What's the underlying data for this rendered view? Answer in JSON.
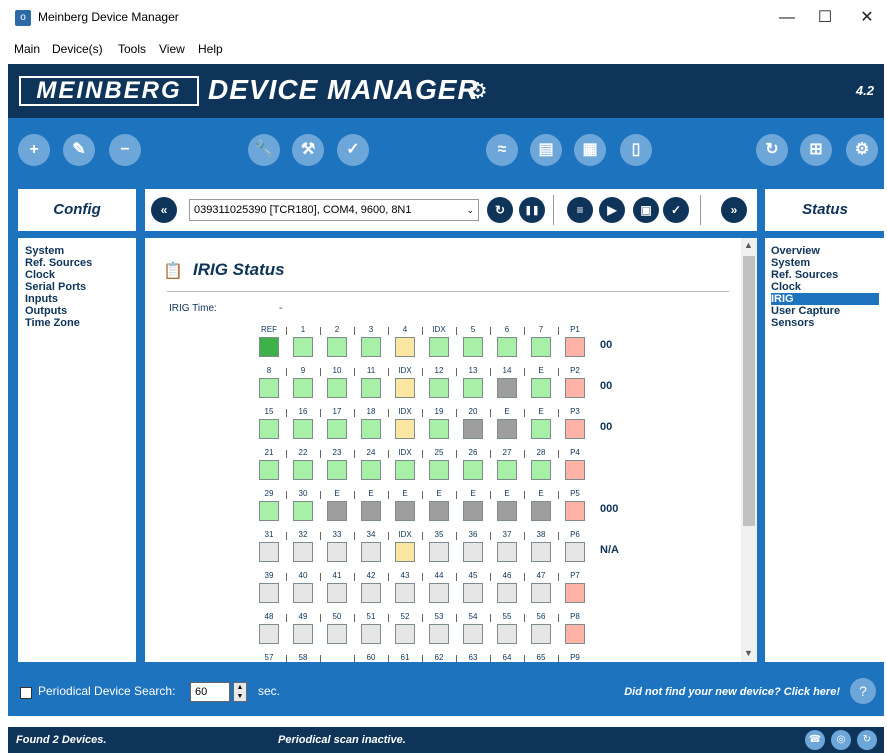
{
  "window": {
    "title": "Meinberg Device Manager",
    "app_icon": "o",
    "minimize": "—",
    "maximize": "☐",
    "close": "✕"
  },
  "menu": [
    "Main",
    "Device(s)",
    "Tools",
    "View",
    "Help"
  ],
  "banner": {
    "logo": "MEINBERG",
    "title": "DEVICE MANAGER",
    "gear": "⚙",
    "version": "4.2"
  },
  "toolbar": {
    "left": [
      {
        "icon": "plus-icon",
        "glyph": "+"
      },
      {
        "icon": "pencil-icon",
        "glyph": "✎"
      },
      {
        "icon": "minus-icon",
        "glyph": "−"
      }
    ],
    "middle": [
      {
        "icon": "wrench-icon",
        "glyph": "🔧"
      },
      {
        "icon": "tools-config-icon",
        "glyph": "⚒"
      },
      {
        "icon": "clipboard-check-icon",
        "glyph": "✓"
      }
    ],
    "right1": [
      {
        "icon": "chart-icon",
        "glyph": "≈"
      },
      {
        "icon": "monitor-chart-icon",
        "glyph": "▤"
      },
      {
        "icon": "grid-icon",
        "glyph": "▦"
      },
      {
        "icon": "device-icon",
        "glyph": "▯"
      }
    ],
    "right2": [
      {
        "icon": "refresh-icon",
        "glyph": "↻"
      },
      {
        "icon": "tree-icon",
        "glyph": "⊞"
      },
      {
        "icon": "gear-icon",
        "glyph": "⚙"
      }
    ]
  },
  "config": {
    "title": "Config",
    "items": [
      "System",
      "Ref. Sources",
      "Clock",
      "Serial Ports",
      "Inputs",
      "Outputs",
      "Time Zone"
    ]
  },
  "status": {
    "title": "Status",
    "items": [
      "Overview",
      "System",
      "Ref. Sources",
      "Clock",
      "IRIG",
      "User Capture",
      "Sensors"
    ],
    "selected": 4
  },
  "device": {
    "selected": "039311025390 [TCR180], COM4, 9600, 8N1",
    "back": "«",
    "refresh": "↻",
    "pause": "❚❚",
    "dropdown_arrow": "⌄"
  },
  "page": {
    "title": "IRIG Status",
    "icon": "clipboard-icon",
    "irig_time_label": "IRIG Time:",
    "irig_time_value": "-"
  },
  "irig_grid": {
    "colors": {
      "G": "#3fb149",
      "g": "#a8f0a8",
      "y": "#fbe7a1",
      "d": "#9e9e9e",
      "l": "#e6e6e6",
      "p": "#ffb3a7"
    },
    "rows": [
      {
        "labels": [
          "REF",
          "1",
          "2",
          "3",
          "4",
          "IDX",
          "5",
          "6",
          "7",
          "P1"
        ],
        "states": "Ggggyggggp",
        "value": "00"
      },
      {
        "labels": [
          "8",
          "9",
          "10",
          "11",
          "IDX",
          "12",
          "13",
          "14",
          "E",
          "P2"
        ],
        "states": "ggggyggdgp",
        "value": "00"
      },
      {
        "labels": [
          "15",
          "16",
          "17",
          "18",
          "IDX",
          "19",
          "20",
          "E",
          "E",
          "P3"
        ],
        "states": "ggggygddgp",
        "value": "00"
      },
      {
        "labels": [
          "21",
          "22",
          "23",
          "24",
          "IDX",
          "25",
          "26",
          "27",
          "28",
          "P4"
        ],
        "states": "gggggggggp",
        "value": ""
      },
      {
        "labels": [
          "29",
          "30",
          "E",
          "E",
          "E",
          "E",
          "E",
          "E",
          "E",
          "P5"
        ],
        "states": "ggdddddddp",
        "value": "000"
      },
      {
        "labels": [
          "31",
          "32",
          "33",
          "34",
          "IDX",
          "35",
          "36",
          "37",
          "38",
          "P6"
        ],
        "states": "llllylllll",
        "value": "N/A"
      },
      {
        "labels": [
          "39",
          "40",
          "41",
          "42",
          "43",
          "44",
          "45",
          "46",
          "47",
          "P7"
        ],
        "states": "lllllllllp",
        "value": ""
      },
      {
        "labels": [
          "48",
          "49",
          "50",
          "51",
          "52",
          "53",
          "54",
          "55",
          "56",
          "P8"
        ],
        "states": "lllllllllp",
        "value": ""
      },
      {
        "labels": [
          "57",
          "58",
          "",
          "60",
          "61",
          "62",
          "63",
          "64",
          "65",
          "P9"
        ],
        "states": "",
        "value": ""
      }
    ]
  },
  "bottom": {
    "periodical_label": "Periodical Device Search:",
    "period_value": "60",
    "sec": "sec.",
    "not_found": "Did not find your new device? Click here!"
  },
  "statusbar": {
    "found": "Found 2 Devices.",
    "scan": "Periodical scan inactive."
  }
}
